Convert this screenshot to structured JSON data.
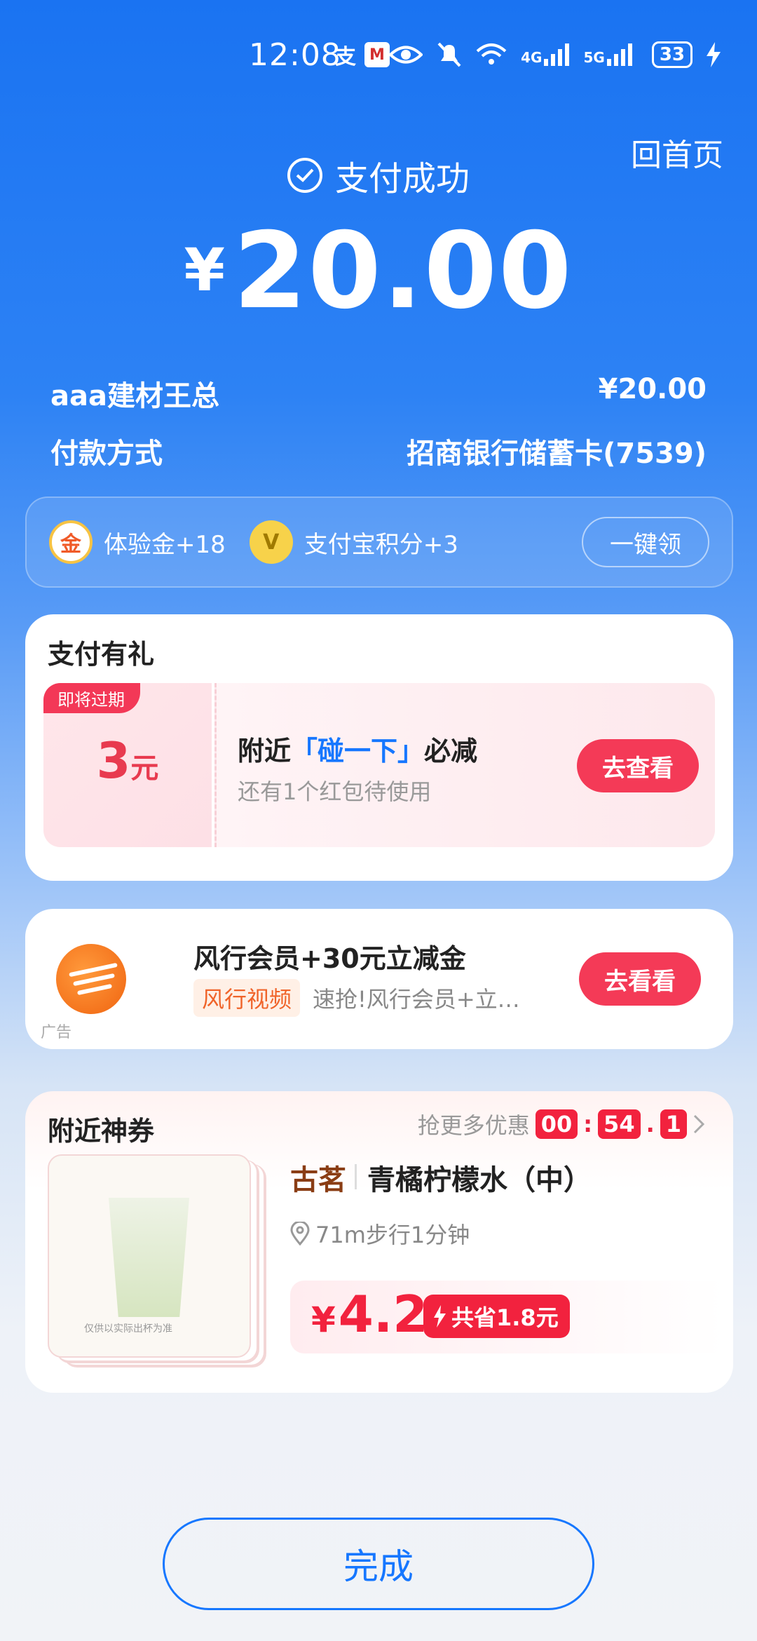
{
  "status_bar": {
    "time": "12:08",
    "battery": "33",
    "network_labels": [
      "4G",
      "5G"
    ]
  },
  "header": {
    "home_label": "回首页",
    "success_label": "支付成功",
    "currency_symbol": "¥",
    "amount": "20.00"
  },
  "payee": {
    "name": "aaa建材王总",
    "amount": "¥20.00"
  },
  "payment_method": {
    "label": "付款方式",
    "value": "招商银行储蓄卡(7539)"
  },
  "rewards": {
    "items": [
      {
        "label": "体验金+18",
        "icon": "gold-coin-icon"
      },
      {
        "label": "支付宝积分+3",
        "icon": "points-icon"
      }
    ],
    "claim_label": "一键领"
  },
  "gift_section": {
    "title": "支付有礼",
    "expire_tag": "即将过期",
    "coupon_value": "3",
    "coupon_unit": "元",
    "coupon_title_pre": "附近",
    "coupon_title_hl": "「碰一下」",
    "coupon_title_post": "必减",
    "coupon_sub": "还有1个红包待使用",
    "button_label": "去查看"
  },
  "ad": {
    "title": "风行会员+30元立减金",
    "chip": "风行视频",
    "desc": "速抢!风行会员+立…",
    "ad_tag": "广告",
    "button_label": "去看看"
  },
  "nearby": {
    "title": "附近神券",
    "more_label": "抢更多优惠",
    "timer": [
      "00",
      "54",
      "1"
    ],
    "brand": "古茗",
    "product": "青橘柠檬水（中）",
    "distance": "71m步行1分钟",
    "price_symbol": "¥",
    "price": "4.2",
    "saving": "共省1.8元",
    "image_caption": "仅供以实际出杯为准"
  },
  "done_label": "完成",
  "colors": {
    "primary_blue": "#1677ff",
    "accent_red": "#f43a57"
  }
}
